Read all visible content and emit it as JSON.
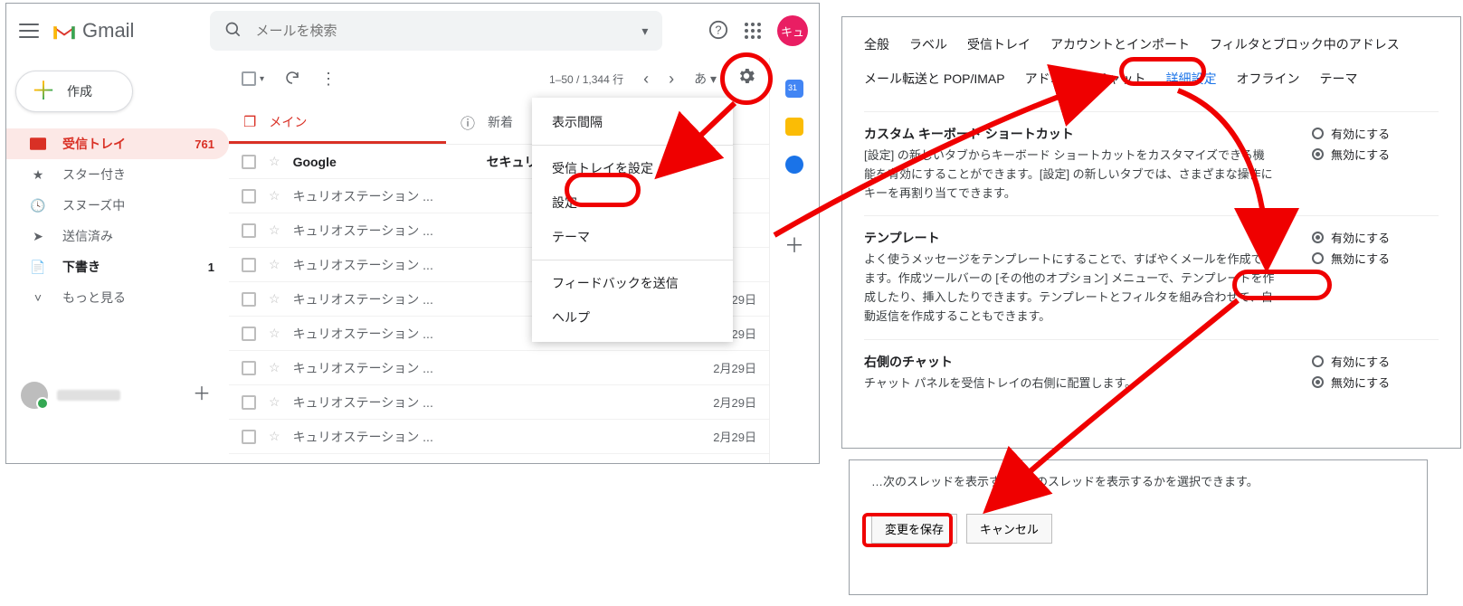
{
  "header": {
    "brand": "Gmail",
    "search_placeholder": "メールを検索",
    "avatar_text": "キュ"
  },
  "compose_label": "作成",
  "sidebar": {
    "items": [
      {
        "icon": "inbox",
        "label": "受信トレイ",
        "count": "761",
        "active": true
      },
      {
        "icon": "star",
        "label": "スター付き"
      },
      {
        "icon": "clock",
        "label": "スヌーズ中"
      },
      {
        "icon": "send",
        "label": "送信済み"
      },
      {
        "icon": "draft",
        "label": "下書き",
        "count": "1",
        "bold": true
      },
      {
        "icon": "more",
        "label": "もっと見る"
      }
    ]
  },
  "toolbar": {
    "range": "1–50 / 1,344 行",
    "ime": "あ"
  },
  "tabs": [
    {
      "label": "メイン",
      "active": true
    },
    {
      "label": "新着"
    }
  ],
  "rows": [
    {
      "sender": "Google",
      "subject": "セキュリティ",
      "date": "",
      "unread": true
    },
    {
      "sender": "キュリオステーション ...",
      "date": ""
    },
    {
      "sender": "キュリオステーション ...",
      "date": ""
    },
    {
      "sender": "キュリオステーション ...",
      "date": ""
    },
    {
      "sender": "キュリオステーション ...",
      "date": "2月29日"
    },
    {
      "sender": "キュリオステーション ...",
      "date": "2月29日"
    },
    {
      "sender": "キュリオステーション ...",
      "date": "2月29日"
    },
    {
      "sender": "キュリオステーション ...",
      "date": "2月29日"
    },
    {
      "sender": "キュリオステーション ...",
      "date": "2月29日"
    }
  ],
  "dropdown": {
    "items": [
      "表示間隔",
      "受信トレイを設定",
      "設定",
      "テーマ",
      "フィードバックを送信",
      "ヘルプ"
    ]
  },
  "settings": {
    "tabs": [
      "全般",
      "ラベル",
      "受信トレイ",
      "アカウントとインポート",
      "フィルタとブロック中のアドレス",
      "メール転送と POP/IMAP",
      "アドオン",
      "チャット",
      "詳細設定",
      "オフライン",
      "テーマ"
    ],
    "selected_tab": "詳細設定",
    "keyboard": {
      "title": "カスタム キーボード ショートカット",
      "desc": "[設定] の新しいタブからキーボード ショートカットをカスタマイズできる機能を有効にすることができます。[設定] の新しいタブでは、さまざまな操作にキーを再割り当てできます。",
      "enable": "有効にする",
      "disable": "無効にする",
      "value": "disable"
    },
    "template": {
      "title": "テンプレート",
      "desc": "よく使うメッセージをテンプレートにすることで、すばやくメールを作成できます。作成ツールバーの [その他のオプション] メニューで、テンプレートを作成したり、挿入したりできます。テンプレートとフィルタを組み合わせて、自動返信を作成することもできます。",
      "enable": "有効にする",
      "disable": "無効にする",
      "value": "enable"
    },
    "chat": {
      "title": "右側のチャット",
      "desc": "チャット パネルを受信トレイの右側に配置します。",
      "enable": "有効にする",
      "disable": "無効にする",
      "value": "disable"
    }
  },
  "save": {
    "desc": "…次のスレッドを表示するか前のスレッドを表示するかを選択できます。",
    "save_label": "変更を保存",
    "cancel_label": "キャンセル"
  }
}
